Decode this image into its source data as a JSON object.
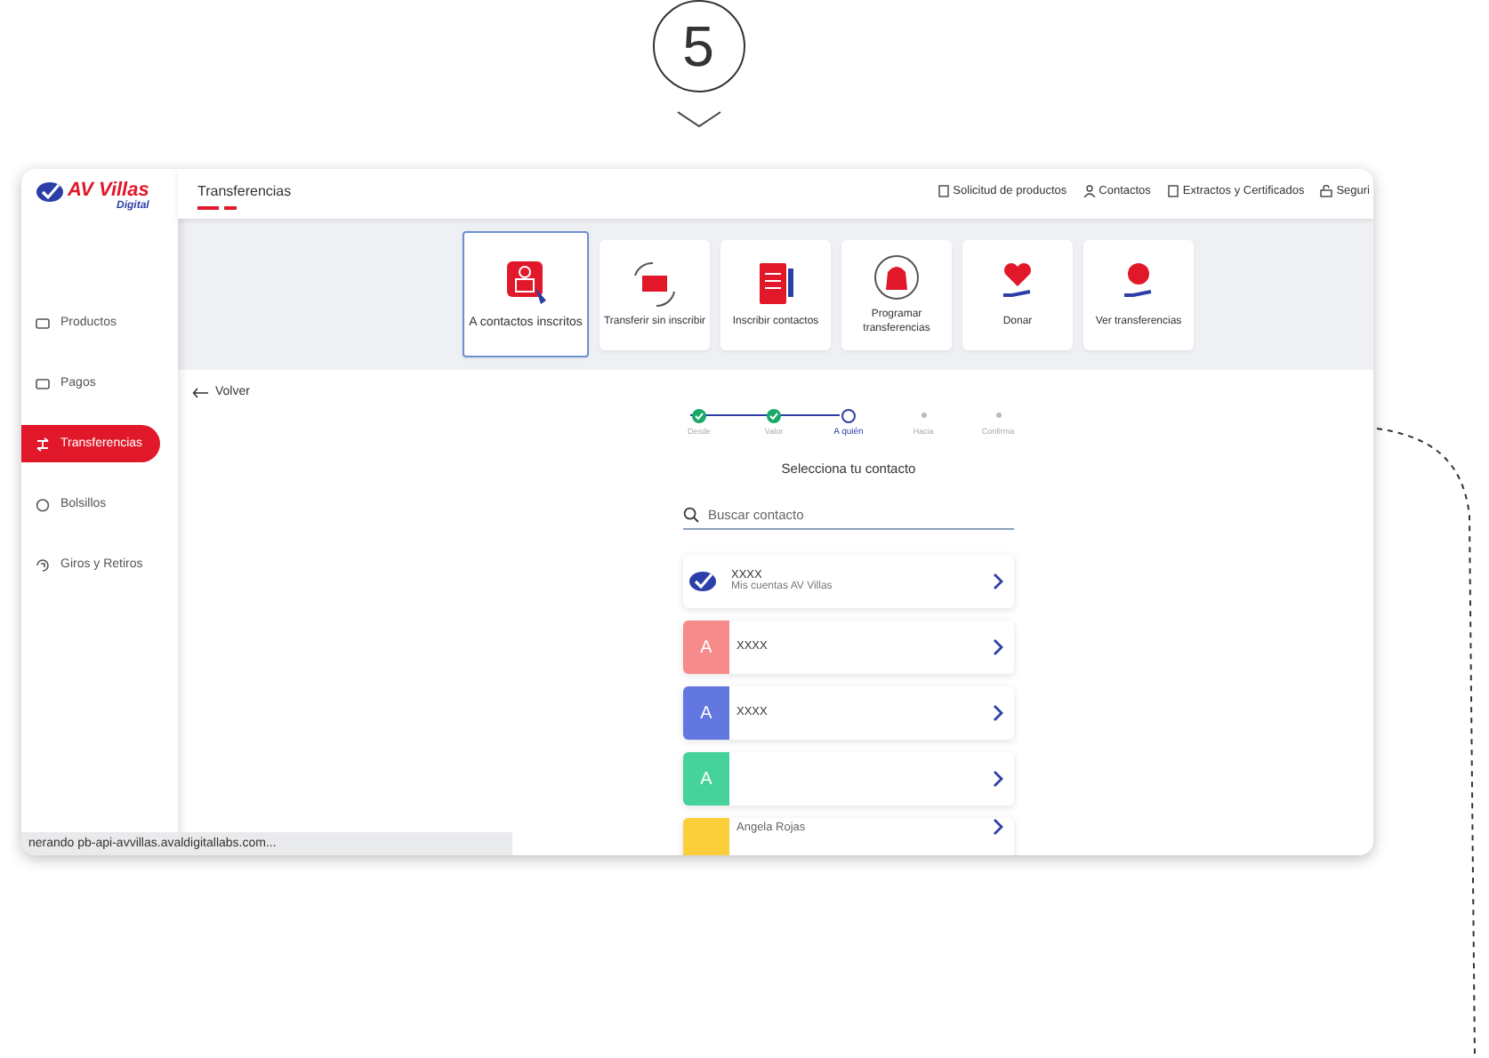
{
  "step_badge": {
    "number": "5"
  },
  "logo": {
    "brand": "AV Villas",
    "tagline": "Digital"
  },
  "sidebar": {
    "items": [
      {
        "label": "Productos",
        "kind": "card",
        "selected": false
      },
      {
        "label": "Pagos",
        "kind": "bill",
        "selected": false
      },
      {
        "label": "Transferencias",
        "kind": "transfer",
        "selected": true
      },
      {
        "label": "Bolsillos",
        "kind": "pocket",
        "selected": false
      },
      {
        "label": "Giros y Retiros",
        "kind": "withdraw",
        "selected": false
      }
    ]
  },
  "header": {
    "title": "Transferencias",
    "nav": [
      {
        "label": "Solicitud de productos",
        "kind": "form"
      },
      {
        "label": "Contactos",
        "kind": "person"
      },
      {
        "label": "Extractos y Certificados",
        "kind": "doc"
      },
      {
        "label": "Seguri",
        "kind": "lock"
      }
    ]
  },
  "tiles": [
    {
      "label": "A contactos inscritos",
      "kind": "contacts",
      "selected": true
    },
    {
      "label": "Transferir sin inscribir",
      "kind": "transfer",
      "selected": false
    },
    {
      "label": "Inscribir contactos",
      "kind": "register",
      "selected": false
    },
    {
      "label": "Programar transferencias",
      "kind": "schedule",
      "selected": false
    },
    {
      "label": "Donar",
      "kind": "donate",
      "selected": false
    },
    {
      "label": "Ver transferencias",
      "kind": "view",
      "selected": false
    }
  ],
  "back_link": "Volver",
  "stepper": [
    {
      "label": "Desde",
      "kind": "done"
    },
    {
      "label": "Valor",
      "kind": "done"
    },
    {
      "label": "A quién",
      "kind": "current"
    },
    {
      "label": "Hacia",
      "kind": "pending"
    },
    {
      "label": "Confirma",
      "kind": "pending"
    }
  ],
  "section_title": "Selecciona tu contacto",
  "search": {
    "placeholder": "Buscar contacto"
  },
  "contacts": [
    {
      "kind": "bank",
      "name": "XXXX",
      "subtitle": "Mis cuentas AV Villas"
    },
    {
      "kind": "avatar",
      "initial": "A",
      "color": "#f58b8b",
      "name": "XXXX"
    },
    {
      "kind": "avatar",
      "initial": "A",
      "color": "#6277e0",
      "name": "XXXX"
    },
    {
      "kind": "avatar",
      "initial": "A",
      "color": "#45d39b"
    },
    {
      "kind": "avatar",
      "color": "#fbcf3a",
      "name": "Angela Rojas"
    }
  ],
  "status_bar": "nerando pb-api-avvillas.avaldigitallabs.com..."
}
